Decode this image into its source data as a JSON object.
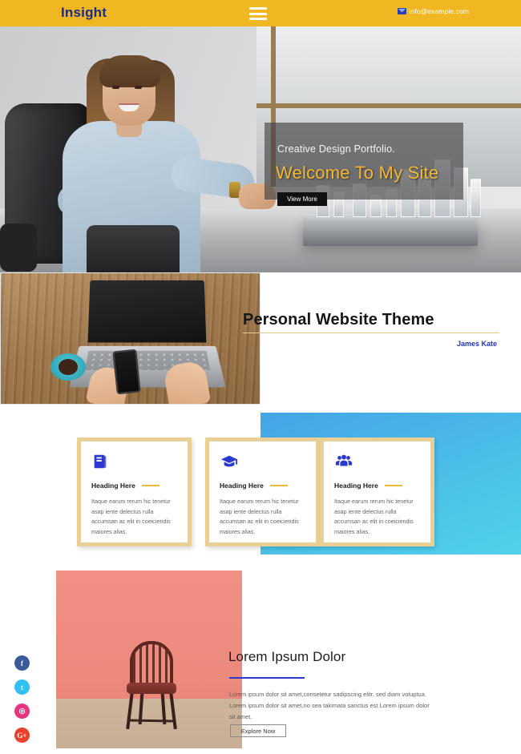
{
  "header": {
    "logo": "Insight",
    "menu_icon": "hamburger-icon",
    "email_icon": "envelope-icon",
    "email": "info@example.com"
  },
  "hero": {
    "subtitle": "Creative Design Portfolio.",
    "title": "Welcome To My Site",
    "button": "View More",
    "image_alt": "businesswoman-in-office-chair",
    "model_alt": "glass-city-architecture-model"
  },
  "about": {
    "title": "Personal Website Theme",
    "author": "James Kate",
    "image_alt": "laptop-coffee-phone-on-wooden-desk"
  },
  "features": {
    "cards": [
      {
        "icon": "book-icon",
        "heading": "Heading Here",
        "body": "Itaque earum rerum hic tenetur asap iente delectus rulla accumsan ac elit in coeiciendis maiores alias."
      },
      {
        "icon": "graduation-cap-icon",
        "heading": "Heading Here",
        "body": "Itaque earum rerum hic tenetur asap iente delectus rulla accumsan ac elit in coeiciendis maiores alias."
      },
      {
        "icon": "users-group-icon",
        "heading": "Heading Here",
        "body": "Itaque earum rerum hic tenetur asap iente delectus rulla accumsan ac elit in coeiciendis maiores alias."
      }
    ]
  },
  "promo": {
    "title": "Lorem Ipsum Dolor",
    "body": "Lorem ipsum dolor sit amet,consetetur sadipscing elitr, sed diam voluptua. Lorem ipsum dolor sit amet,no sea takimata sanctus est Lorem ipsum dolor sit amet.",
    "button": "Explore Now",
    "image_alt": "wooden-chair-against-pink-wall"
  },
  "social": [
    {
      "name": "facebook",
      "glyph": "f"
    },
    {
      "name": "twitter",
      "glyph": "t"
    },
    {
      "name": "instagram",
      "glyph": "◎"
    },
    {
      "name": "google-plus",
      "glyph": "G+"
    }
  ],
  "colors": {
    "header_gold": "#f0b722",
    "logo_navy": "#1a2a8a",
    "hero_accent": "#f7b733",
    "card_border": "#e9cf96",
    "panel_blue": "#4bbfe8",
    "icon_blue": "#2b39cf",
    "link_blue": "#2233bb"
  }
}
